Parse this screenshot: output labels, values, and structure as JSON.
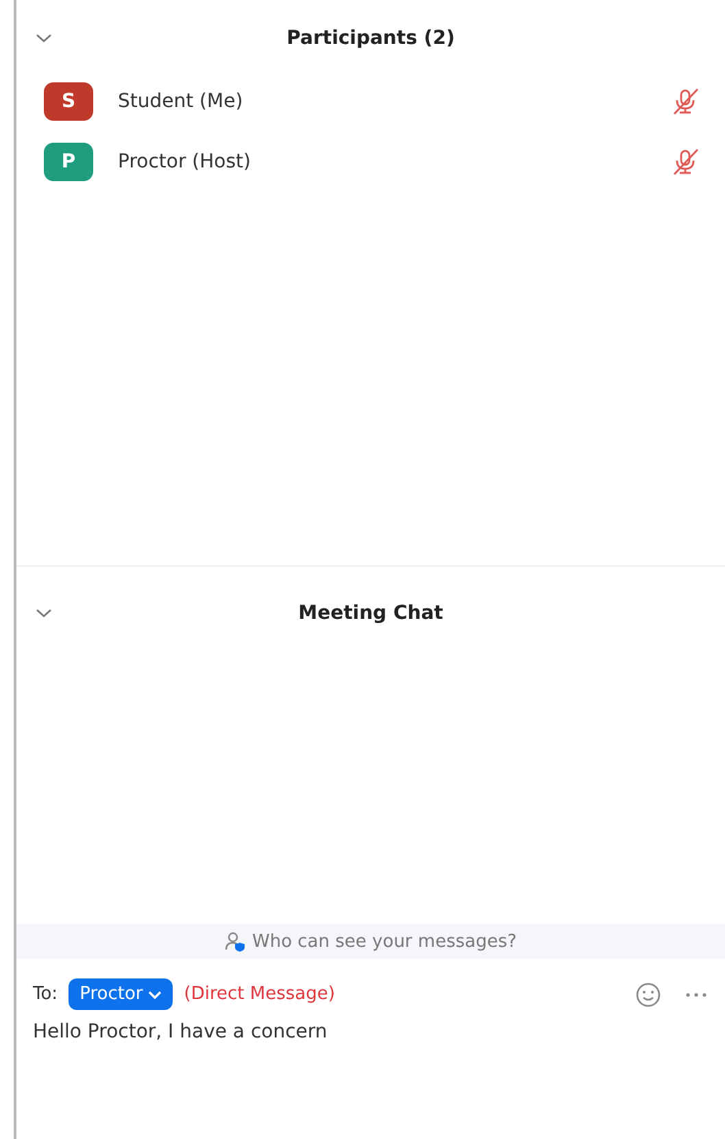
{
  "participants": {
    "title": "Participants (2)",
    "expanded": true,
    "items": [
      {
        "initial": "S",
        "name": "Student (Me)",
        "color": "#c0392b",
        "muted": true
      },
      {
        "initial": "P",
        "name": "Proctor (Host)",
        "color": "#1e9e7e",
        "muted": true
      }
    ]
  },
  "chat": {
    "title": "Meeting Chat",
    "expanded": true,
    "notice": "Who can see your messages?",
    "to_label": "To:",
    "recipient": "Proctor",
    "recipient_note": "(Direct Message)",
    "message": "Hello Proctor, I have a concern"
  }
}
